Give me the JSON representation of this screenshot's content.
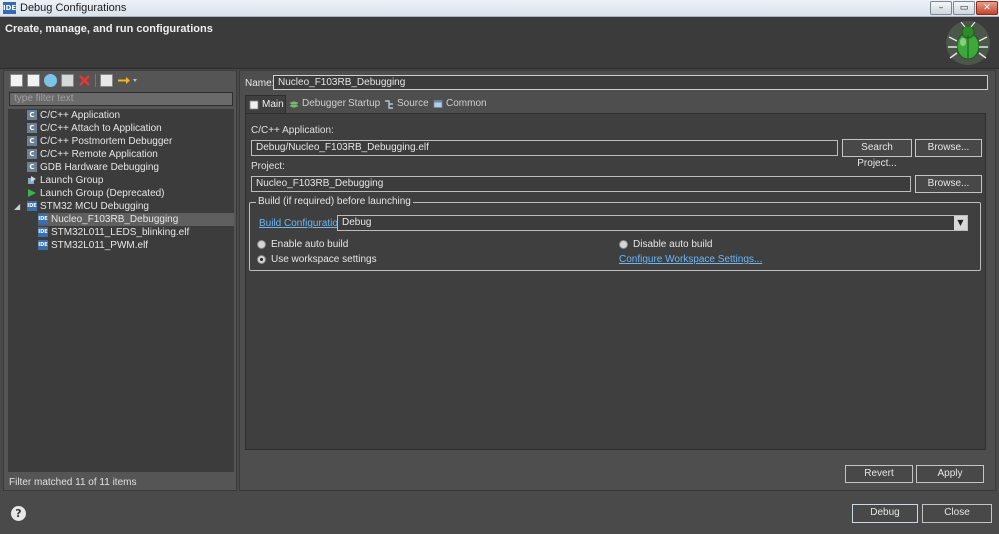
{
  "window": {
    "title": "Debug Configurations",
    "icon_text": "IDE",
    "min_glyph": "–",
    "max_glyph": "▭",
    "close_glyph": "✕"
  },
  "banner": {
    "title": "Create, manage, and run configurations"
  },
  "toolbar": {
    "icons": [
      "new-configuration-icon",
      "new-prototype-icon",
      "export-icon",
      "duplicate-icon",
      "delete-icon",
      "collapse-all-icon",
      "filter-icon"
    ]
  },
  "filter": {
    "placeholder": "type filter text"
  },
  "tree": {
    "items": [
      {
        "label": "C/C++ Application",
        "icon": "C"
      },
      {
        "label": "C/C++ Attach to Application",
        "icon": "C"
      },
      {
        "label": "C/C++ Postmortem Debugger",
        "icon": "C"
      },
      {
        "label": "C/C++ Remote Application",
        "icon": "C"
      },
      {
        "label": "GDB Hardware Debugging",
        "icon": "C"
      },
      {
        "label": "Launch Group",
        "icon": "launch-group-icon"
      },
      {
        "label": "Launch Group (Deprecated)",
        "icon": "launch-group-deprecated-icon"
      },
      {
        "label": "STM32 MCU Debugging",
        "icon": "IDE",
        "expander": "◢"
      },
      {
        "label": "Nucleo_F103RB_Debugging",
        "icon": "IDE"
      },
      {
        "label": "STM32L011_LEDS_blinking.elf",
        "icon": "IDE"
      },
      {
        "label": "STM32L011_PWM.elf",
        "icon": "IDE"
      }
    ],
    "status": "Filter matched 11 of 11 items"
  },
  "config": {
    "name_label": "Name:",
    "name_value": "Nucleo_F103RB_Debugging",
    "tabs": [
      {
        "label": "Main",
        "icon": "main-tab-icon"
      },
      {
        "label": "Debugger",
        "icon": "debugger-tab-icon"
      },
      {
        "label": "Startup",
        "icon": ""
      },
      {
        "label": "Source",
        "icon": "source-tab-icon"
      },
      {
        "label": "Common",
        "icon": "common-tab-icon"
      }
    ],
    "application_label": "C/C++ Application:",
    "application_value": "Debug/Nucleo_F103RB_Debugging.elf",
    "search_project_button": "Search Project...",
    "browse_button": "Browse...",
    "project_label": "Project:",
    "project_value": "Nucleo_F103RB_Debugging",
    "project_browse_button": "Browse...",
    "build_group_title": "Build (if required) before launching",
    "build_config_link": "Build Configuration:",
    "build_config_value": "Debug",
    "select_arrow": "▼",
    "enable_auto_build": "Enable auto build",
    "disable_auto_build": "Disable auto build",
    "use_workspace_settings": "Use workspace settings",
    "configure_workspace_link": "Configure Workspace Settings..."
  },
  "footer": {
    "revert_button": "Revert",
    "apply_button": "Apply",
    "debug_button": "Debug",
    "close_button": "Close",
    "help_glyph": "?"
  }
}
